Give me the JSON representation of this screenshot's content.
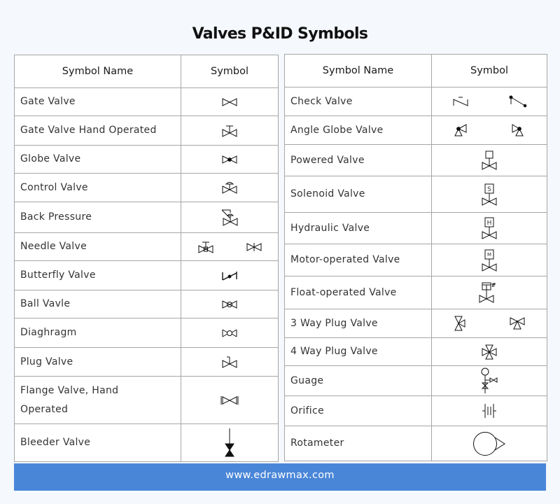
{
  "title": "Valves P&ID Symbols",
  "left_table": {
    "headers": [
      "Symbol Name",
      "Symbol"
    ],
    "rows": [
      {
        "name": "Gate Valve",
        "symbol": "gate-valve-symbol"
      },
      {
        "name": "Gate Valve Hand Operated",
        "symbol": "gate-valve-hand-operated-symbol"
      },
      {
        "name": "Globe Valve",
        "symbol": "globe-valve-symbol"
      },
      {
        "name": "Control Valve",
        "symbol": "control-valve-symbol"
      },
      {
        "name": "Back Pressure",
        "symbol": "back-pressure-symbol"
      },
      {
        "name": "Needle Valve",
        "symbol": "needle-valve-symbol"
      },
      {
        "name": "Butterfly Valve",
        "symbol": "butterfly-valve-symbol"
      },
      {
        "name": "Ball Vavle",
        "symbol": "ball-valve-symbol"
      },
      {
        "name": "Diaghragm",
        "symbol": "diaphragm-valve-symbol"
      },
      {
        "name": "Plug Valve",
        "symbol": "plug-valve-symbol"
      },
      {
        "name": "Flange Valve, Hand Operated",
        "symbol": "flange-valve-symbol"
      },
      {
        "name": "Bleeder Valve",
        "symbol": "bleeder-valve-symbol"
      }
    ]
  },
  "right_table": {
    "headers": [
      "Symbol Name",
      "Symbol"
    ],
    "rows": [
      {
        "name": "Check Valve",
        "symbol": "check-valve-symbol"
      },
      {
        "name": "Angle Globe Valve",
        "symbol": "angle-globe-valve-symbol"
      },
      {
        "name": "Powered Valve",
        "symbol": "powered-valve-symbol"
      },
      {
        "name": "Solenoid Valve",
        "symbol": "solenoid-valve-symbol",
        "label": "S"
      },
      {
        "name": "Hydraulic Valve",
        "symbol": "hydraulic-valve-symbol",
        "label": "H"
      },
      {
        "name": "Motor-operated Valve",
        "symbol": "motor-operated-valve-symbol",
        "label": "M"
      },
      {
        "name": "Float-operated Valve",
        "symbol": "float-operated-valve-symbol"
      },
      {
        "name": "3 Way Plug Valve",
        "symbol": "three-way-plug-valve-symbol"
      },
      {
        "name": "4 Way Plug Valve",
        "symbol": "four-way-plug-valve-symbol"
      },
      {
        "name": "Guage",
        "symbol": "gauge-symbol"
      },
      {
        "name": "Orifice",
        "symbol": "orifice-symbol"
      },
      {
        "name": "Rotameter",
        "symbol": "rotameter-symbol"
      }
    ]
  },
  "footer": {
    "text": "www.edrawmax.com"
  },
  "colors": {
    "footer_bg": "#4a86d8",
    "background": "#f5f8fc",
    "border": "#a6a6a6"
  }
}
